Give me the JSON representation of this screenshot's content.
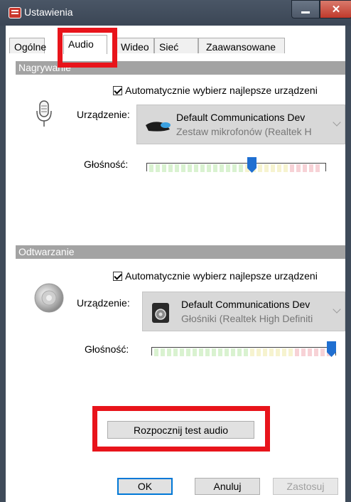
{
  "window": {
    "title": "Ustawienia"
  },
  "tabs": [
    {
      "label": "Ogólne"
    },
    {
      "label": "Audio"
    },
    {
      "label": "Wideo"
    },
    {
      "label": "Sieć"
    },
    {
      "label": "Zaawansowane"
    }
  ],
  "recording": {
    "header": "Nagrywanie",
    "auto_select_label": "Automatycznie wybierz najlepsze urządzeni",
    "auto_select_checked": true,
    "device_label": "Urządzenie:",
    "device_name": "Default Communications Dev",
    "device_sub": "Zestaw mikrofonów (Realtek H",
    "volume_label": "Głośność:",
    "volume_level": 0.59
  },
  "playback": {
    "header": "Odtwarzanie",
    "auto_select_label": "Automatycznie wybierz najlepsze urządzeni",
    "auto_select_checked": true,
    "device_label": "Urządzenie:",
    "device_name": "Default Communications Dev",
    "device_sub": "Głośniki (Realtek High Definiti",
    "volume_label": "Głośność:",
    "volume_level": 1.0
  },
  "test_button": "Rozpocznij test audio",
  "footer": {
    "ok": "OK",
    "cancel": "Anuluj",
    "apply": "Zastosuj"
  },
  "colors": {
    "highlight_box": "#e8141b",
    "thumb": "#1f6fd1",
    "section_header": "#a3a3a3"
  }
}
